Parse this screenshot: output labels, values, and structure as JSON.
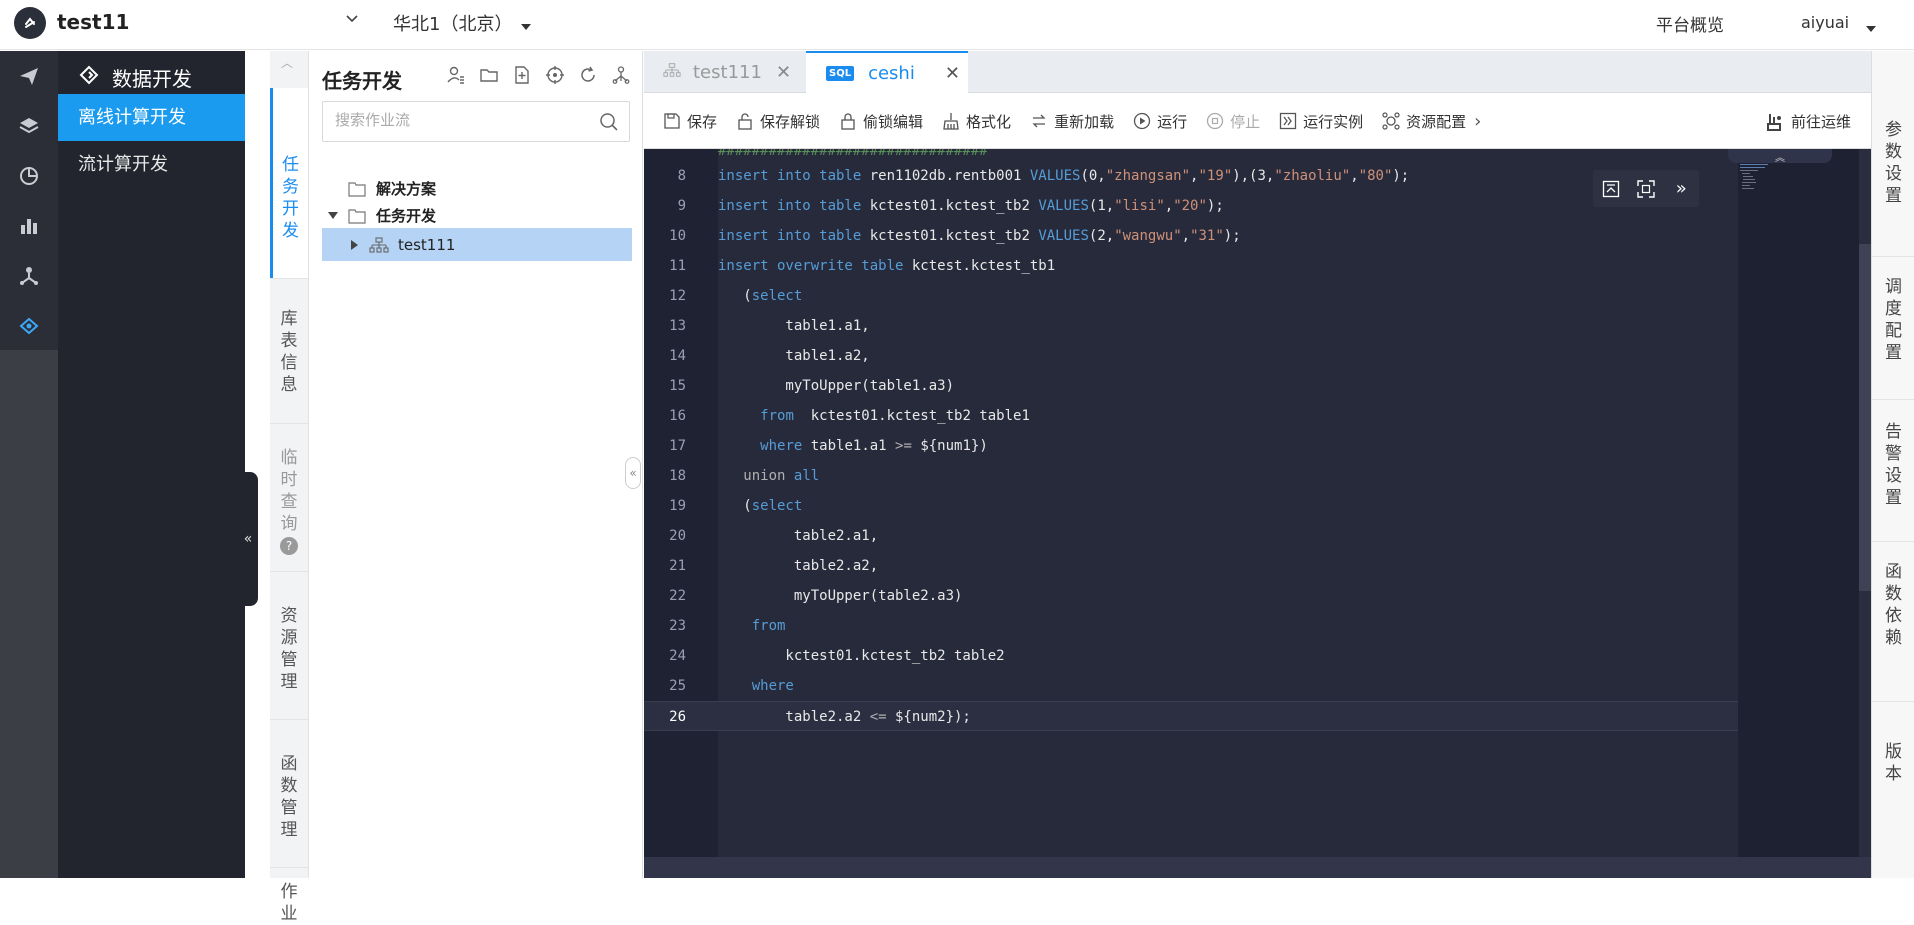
{
  "header": {
    "app_title": "test11",
    "region": "华北1（北京）",
    "platform_link": "平台概览",
    "user": "aiyuai"
  },
  "rail_icons": [
    "send-icon",
    "layers-icon",
    "pie-chart-icon",
    "chart-bars-icon",
    "cluster-icon",
    "workflow-icon"
  ],
  "nav": {
    "header": "数据开发",
    "items": [
      {
        "label": "离线计算开发",
        "active": true
      },
      {
        "label": "流计算开发",
        "active": false
      }
    ]
  },
  "vtabs": [
    {
      "label": "任务开发",
      "state": "active"
    },
    {
      "label": "库表信息",
      "state": "normal"
    },
    {
      "label": "临时查询",
      "state": "disabled"
    },
    {
      "label": "资源管理",
      "state": "normal"
    },
    {
      "label": "函数管理",
      "state": "normal"
    },
    {
      "label": "作业",
      "state": "normal"
    }
  ],
  "tree_pane": {
    "title": "任务开发",
    "search_placeholder": "搜索作业流",
    "nodes": [
      {
        "label": "解决方案"
      },
      {
        "label": "任务开发"
      },
      {
        "label": "test111"
      }
    ]
  },
  "editor_tabs": [
    {
      "label": "test111",
      "type": "workflow"
    },
    {
      "label": "ceshi",
      "type": "sql",
      "badge": "SQL"
    }
  ],
  "toolbar": {
    "save": "保存",
    "unlock": "保存解锁",
    "steal_edit": "偷锁编辑",
    "format": "格式化",
    "reload": "重新加载",
    "run": "运行",
    "stop": "停止",
    "run_instance": "运行实例",
    "resource_config": "资源配置",
    "goto_ops": "前往运维"
  },
  "code": {
    "current_line": 26,
    "lines": [
      {
        "n": "8",
        "html": "<span class='kw'>insert into table</span> ren1102db.rentb001 <span class='kw'>VALUES</span>(0,<span class='str'>\"zhangsan\"</span>,<span class='str'>\"19\"</span>),(3,<span class='str'>\"zhaoliu\"</span>,<span class='str'>\"80\"</span>);"
      },
      {
        "n": "9",
        "html": "<span class='kw'>insert into table</span> kctest01.kctest_tb2 <span class='kw'>VALUES</span>(1,<span class='str'>\"lisi\"</span>,<span class='str'>\"20\"</span>);"
      },
      {
        "n": "10",
        "html": "<span class='kw'>insert into table</span> kctest01.kctest_tb2 <span class='kw'>VALUES</span>(2,<span class='str'>\"wangwu\"</span>,<span class='str'>\"31\"</span>);"
      },
      {
        "n": "11",
        "html": "<span class='kw'>insert overwrite table</span> kctest.kctest_tb1"
      },
      {
        "n": "12",
        "html": "   (<span class='kw'>select</span>"
      },
      {
        "n": "13",
        "html": "        table1.a1,"
      },
      {
        "n": "14",
        "html": "        table1.a2,"
      },
      {
        "n": "15",
        "html": "        myToUpper(table1.a3)"
      },
      {
        "n": "16",
        "html": "     <span class='kw'>from</span>  kctest01.kctest_tb2 table1"
      },
      {
        "n": "17",
        "html": "     <span class='kw'>where</span> table1.a1 <span class='op'>&gt;=</span> ${num1})"
      },
      {
        "n": "18",
        "html": "   <span class='op'>union</span> <span class='kw'>all</span>"
      },
      {
        "n": "19",
        "html": "   (<span class='kw'>select</span>"
      },
      {
        "n": "20",
        "html": "         table2.a1,"
      },
      {
        "n": "21",
        "html": "         table2.a2,"
      },
      {
        "n": "22",
        "html": "         myToUpper(table2.a3)"
      },
      {
        "n": "23",
        "html": "    <span class='kw'>from</span>"
      },
      {
        "n": "24",
        "html": "        kctest01.kctest_tb2 table2"
      },
      {
        "n": "25",
        "html": "    <span class='kw'>where</span>"
      },
      {
        "n": "26",
        "html": "        table2.a2 <span class='op'>&lt;=</span> ${num2});"
      }
    ]
  },
  "right_tabs": [
    "参数设置",
    "调度配置",
    "告警设置",
    "函数依赖",
    "版本"
  ],
  "colors": {
    "accent": "#1a8cf0",
    "nav_active": "#1a9bf0",
    "editor_bg": "#272a3b",
    "keyword": "#569cd6",
    "string": "#ce9178"
  }
}
